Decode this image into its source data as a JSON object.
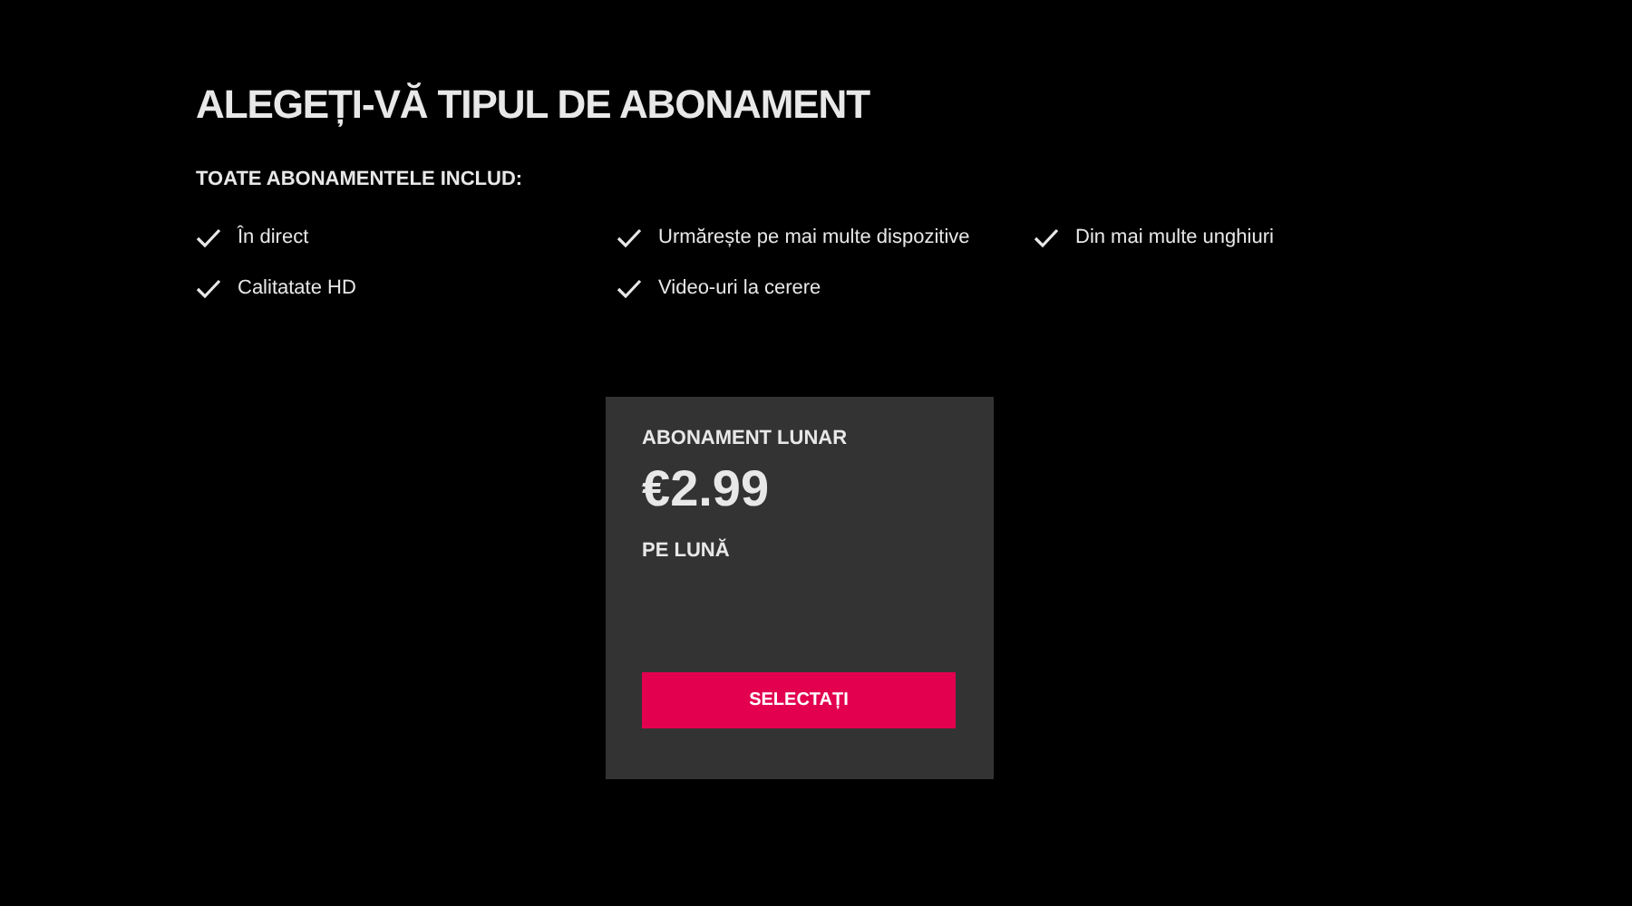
{
  "title": "ALEGEȚI-VĂ TIPUL DE ABONAMENT",
  "includes_heading": "TOATE ABONAMENTELE INCLUD:",
  "features": [
    "În direct",
    "Urmărește pe mai multe dispozitive",
    "Din mai multe unghiuri",
    "Calitatate HD",
    "Video-uri la cerere"
  ],
  "plan": {
    "name": "ABONAMENT LUNAR",
    "price": "€2.99",
    "period": "PE LUNĂ",
    "button": "SELECTAȚI"
  }
}
